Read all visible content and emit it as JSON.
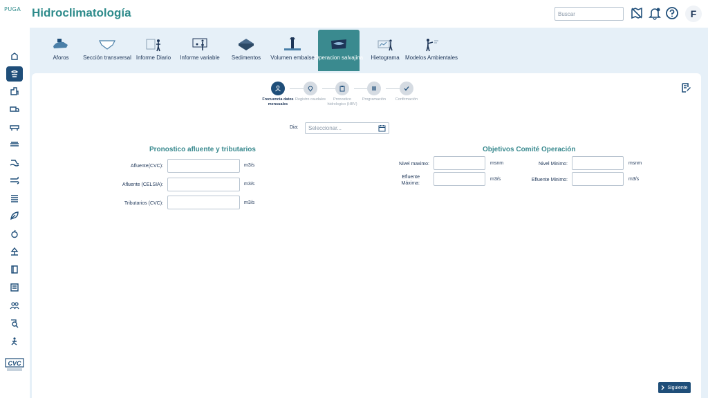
{
  "header": {
    "logo": "PUGA",
    "title": "Hidroclimatología",
    "search_placeholder": "Buscar",
    "avatar_initial": "F"
  },
  "tabs": [
    {
      "label": "Aforos",
      "icon": "aforos-icon"
    },
    {
      "label": "Sección transversal",
      "icon": "seccion-icon"
    },
    {
      "label": "Informe Diario",
      "icon": "informe-diario-icon"
    },
    {
      "label": "Informe variable",
      "icon": "informe-variable-icon"
    },
    {
      "label": "Sedimentos",
      "icon": "sedimentos-icon"
    },
    {
      "label": "Volumen embalse",
      "icon": "volumen-icon"
    },
    {
      "label": "Operacion salvajina",
      "icon": "operacion-icon",
      "active": true
    },
    {
      "label": "Hietograma",
      "icon": "hietograma-icon"
    },
    {
      "label": "Modelos Ambientales",
      "icon": "modelos-icon"
    }
  ],
  "stepper": [
    {
      "label": "Frecuencia datos mensuales",
      "active": true
    },
    {
      "label": "Registro caudales",
      "active": false
    },
    {
      "label": "Pronostico hidrologico (HBV)",
      "active": false
    },
    {
      "label": "Programación",
      "active": false
    },
    {
      "label": "Confirmación",
      "active": false
    }
  ],
  "dia": {
    "label": "Dia:",
    "placeholder": "Seleccionar..."
  },
  "left_section": {
    "title": "Pronostico afluente y tributarios",
    "fields": [
      {
        "label": "Afluente(CVC):",
        "unit": "m3/s"
      },
      {
        "label": "Afluente (CELSIA):",
        "unit": "m3/s"
      },
      {
        "label": "Tributarios (CVC):",
        "unit": "m3/s"
      }
    ]
  },
  "right_section": {
    "title": "Objetivos Comité Operación",
    "fields": [
      {
        "label": "Nivel maximo:",
        "unit": "msnm"
      },
      {
        "label": "Nivel Minimo:",
        "unit": "msnm"
      },
      {
        "label": "Efluente Máxima:",
        "unit": "m3/s"
      },
      {
        "label": "Efluente Minimo:",
        "unit": "m3/s"
      }
    ]
  },
  "next_button": "Siguiente",
  "colors": {
    "accent": "#3a8a8f",
    "primary": "#1f4e79",
    "background": "#e6f0f8"
  }
}
